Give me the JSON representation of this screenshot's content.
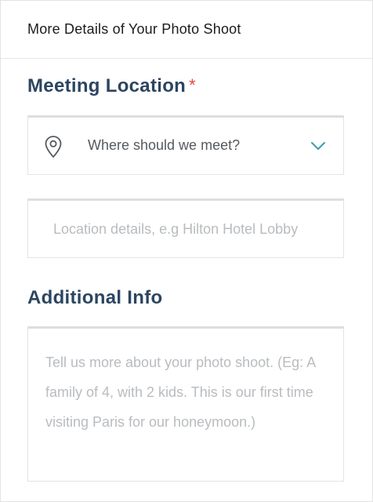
{
  "card": {
    "title": "More Details of Your Photo Shoot"
  },
  "meeting_location": {
    "label": "Meeting Location",
    "required_marker": "*",
    "select_placeholder": "Where should we meet?",
    "select_icon": "map-pin-icon",
    "dropdown_icon": "chevron-down-icon",
    "details_placeholder": "Location details, e.g Hilton Hotel Lobby"
  },
  "additional_info": {
    "label": "Additional Info",
    "placeholder": "Tell us more about your photo shoot. (Eg: A family of 4, with 2 kids. This is our first time visiting Paris for our honeymoon.)"
  },
  "colors": {
    "label": "#2c4561",
    "required": "#e0483f",
    "accent_chevron": "#3aa0a8",
    "placeholder": "#b9bcbf"
  }
}
